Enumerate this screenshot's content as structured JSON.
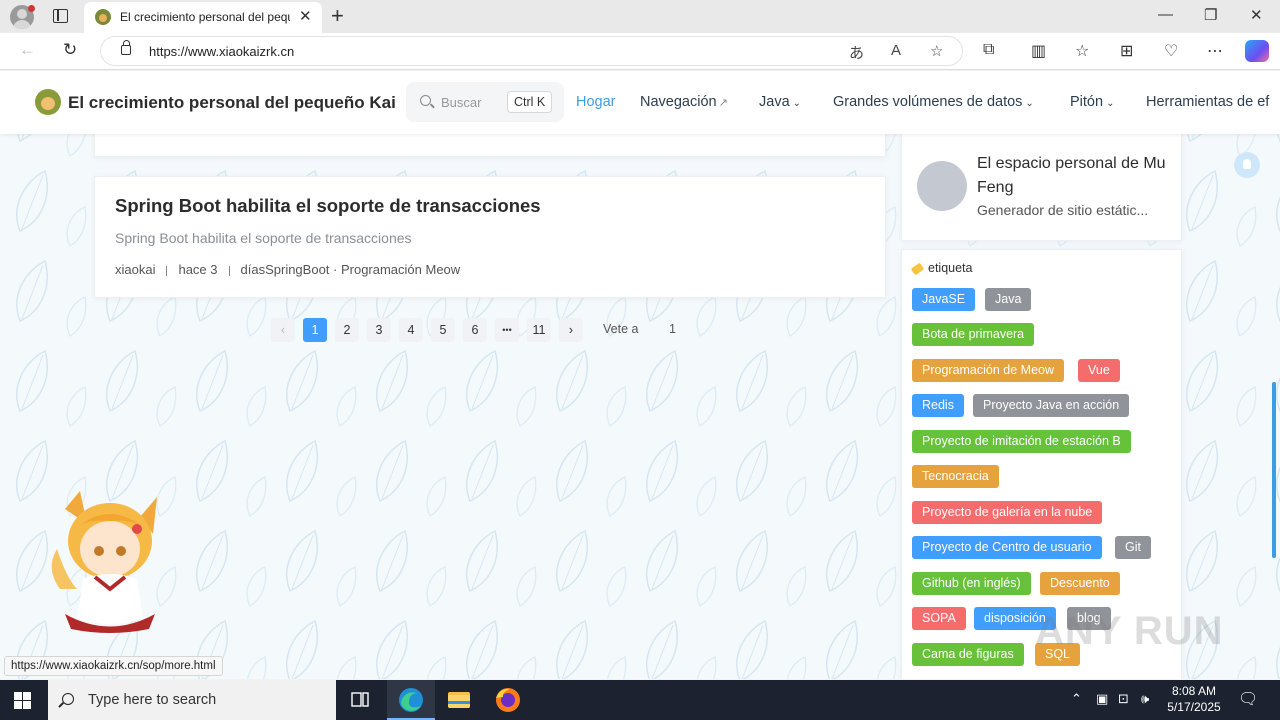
{
  "browser": {
    "tab_title": "El crecimiento personal del pequeño Kai",
    "url": "https://www.xiaokaizrk.cn",
    "icons": [
      "profile-icon",
      "tab-actions-icon",
      "close-icon",
      "new-tab-icon",
      "minimize-icon",
      "maximize-icon",
      "window-close-icon",
      "back-icon",
      "refresh-icon",
      "lock-icon",
      "translate-icon",
      "read-aloud-icon",
      "favorite-star-icon",
      "extensions-icon",
      "split-screen-icon",
      "favorites-icon",
      "collections-icon",
      "browser-essentials-icon",
      "more-icon",
      "copilot-icon"
    ]
  },
  "site": {
    "title": "El crecimiento personal del pequeño Kai",
    "search_placeholder": "Buscar",
    "search_shortcut": "Ctrl K",
    "nav": [
      {
        "label": "Hogar",
        "active": true
      },
      {
        "label": "Navegación",
        "external": true
      },
      {
        "label": "Java",
        "dropdown": true
      },
      {
        "label": "Grandes volúmenes de datos",
        "dropdown": true
      },
      {
        "label": "Pitón",
        "dropdown": true
      },
      {
        "label": "Herramientas de ef"
      }
    ]
  },
  "post": {
    "title": "Spring Boot habilita el soporte de transacciones",
    "description": "Spring Boot habilita el soporte de transacciones",
    "author": "xiaokai",
    "time": "hace 3",
    "tags": "díasSpringBoot · Programación Meow"
  },
  "pagination": {
    "prev": "‹",
    "pages": [
      "1",
      "2",
      "3",
      "4",
      "5",
      "6",
      "•••",
      "11"
    ],
    "current": "1",
    "next": "›",
    "goto_label": "Vete a",
    "goto_value": "1"
  },
  "profile": {
    "name": "El espacio personal de Mu Feng",
    "subtitle": "Generador de sitio estátic..."
  },
  "tags": {
    "heading": "etiqueta",
    "colors": {
      "blue": "#409eff",
      "gray": "#909399",
      "green": "#67c23a",
      "orange": "#e6a23c",
      "red": "#f56c6c"
    },
    "items": [
      {
        "label": "JavaSE",
        "color": "#409eff"
      },
      {
        "label": "Java",
        "color": "#909399"
      },
      {
        "label": "Bota de primavera",
        "color": "#67c23a"
      },
      {
        "label": "Programación de Meow",
        "color": "#e6a23c"
      },
      {
        "label": "Vue",
        "color": "#f56c6c"
      },
      {
        "label": "Redis",
        "color": "#409eff"
      },
      {
        "label": "Proyecto Java en acción",
        "color": "#909399"
      },
      {
        "label": "Proyecto de imitación de estación B",
        "color": "#67c23a"
      },
      {
        "label": "Tecnocracia",
        "color": "#e6a23c"
      },
      {
        "label": "Proyecto de galería en la nube",
        "color": "#f56c6c"
      },
      {
        "label": "Proyecto de Centro de usuario",
        "color": "#409eff"
      },
      {
        "label": "Git",
        "color": "#909399"
      },
      {
        "label": "Github (en inglés)",
        "color": "#67c23a"
      },
      {
        "label": "Descuento",
        "color": "#e6a23c"
      },
      {
        "label": "SOPA",
        "color": "#f56c6c"
      },
      {
        "label": "disposición",
        "color": "#409eff"
      },
      {
        "label": "blog",
        "color": "#909399"
      },
      {
        "label": "Cama de figuras",
        "color": "#67c23a"
      },
      {
        "label": "SQL",
        "color": "#e6a23c"
      }
    ]
  },
  "status_url": "https://www.xiaokaizrk.cn/sop/more.html",
  "watermark": "ANY RUN",
  "taskbar": {
    "search_placeholder": "Type here to search",
    "time": "8:08 AM",
    "date": "5/17/2025"
  }
}
